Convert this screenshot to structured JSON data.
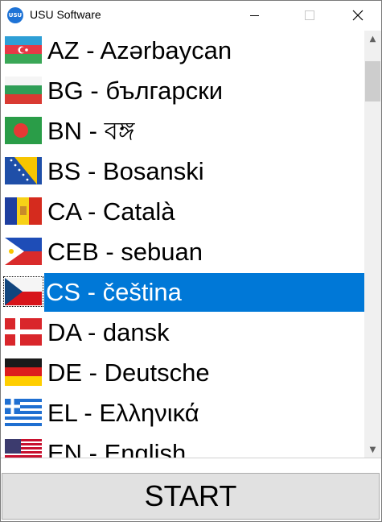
{
  "window": {
    "title": "USU Software",
    "icon_text": "USU",
    "minimize_icon": "minimize-icon",
    "maximize_icon": "maximize-icon",
    "close_icon": "close-icon"
  },
  "languages": [
    {
      "label": "AZ - Azərbaycan",
      "flag": "flag-az-icon",
      "selected": false
    },
    {
      "label": "BG - български",
      "flag": "flag-bg-icon",
      "selected": false
    },
    {
      "label": "BN - বঙ্গ",
      "flag": "flag-bd-icon",
      "selected": false
    },
    {
      "label": "BS - Bosanski",
      "flag": "flag-ba-icon",
      "selected": false
    },
    {
      "label": "CA - Català",
      "flag": "flag-ad-icon",
      "selected": false
    },
    {
      "label": "CEB - sebuan",
      "flag": "flag-ph-icon",
      "selected": false
    },
    {
      "label": "CS - čeština",
      "flag": "flag-cz-icon",
      "selected": true
    },
    {
      "label": "DA - dansk",
      "flag": "flag-dk-icon",
      "selected": false
    },
    {
      "label": "DE - Deutsche",
      "flag": "flag-de-icon",
      "selected": false
    },
    {
      "label": "EL - Ελληνικά",
      "flag": "flag-gr-icon",
      "selected": false
    },
    {
      "label": "EN - English",
      "flag": "flag-us-icon",
      "selected": false
    }
  ],
  "scrollbar": {
    "up_icon": "scroll-up-icon",
    "down_icon": "scroll-down-icon"
  },
  "start_button": {
    "label": "START"
  },
  "colors": {
    "selection": "#0078d7",
    "button_bg": "#e1e1e1"
  }
}
